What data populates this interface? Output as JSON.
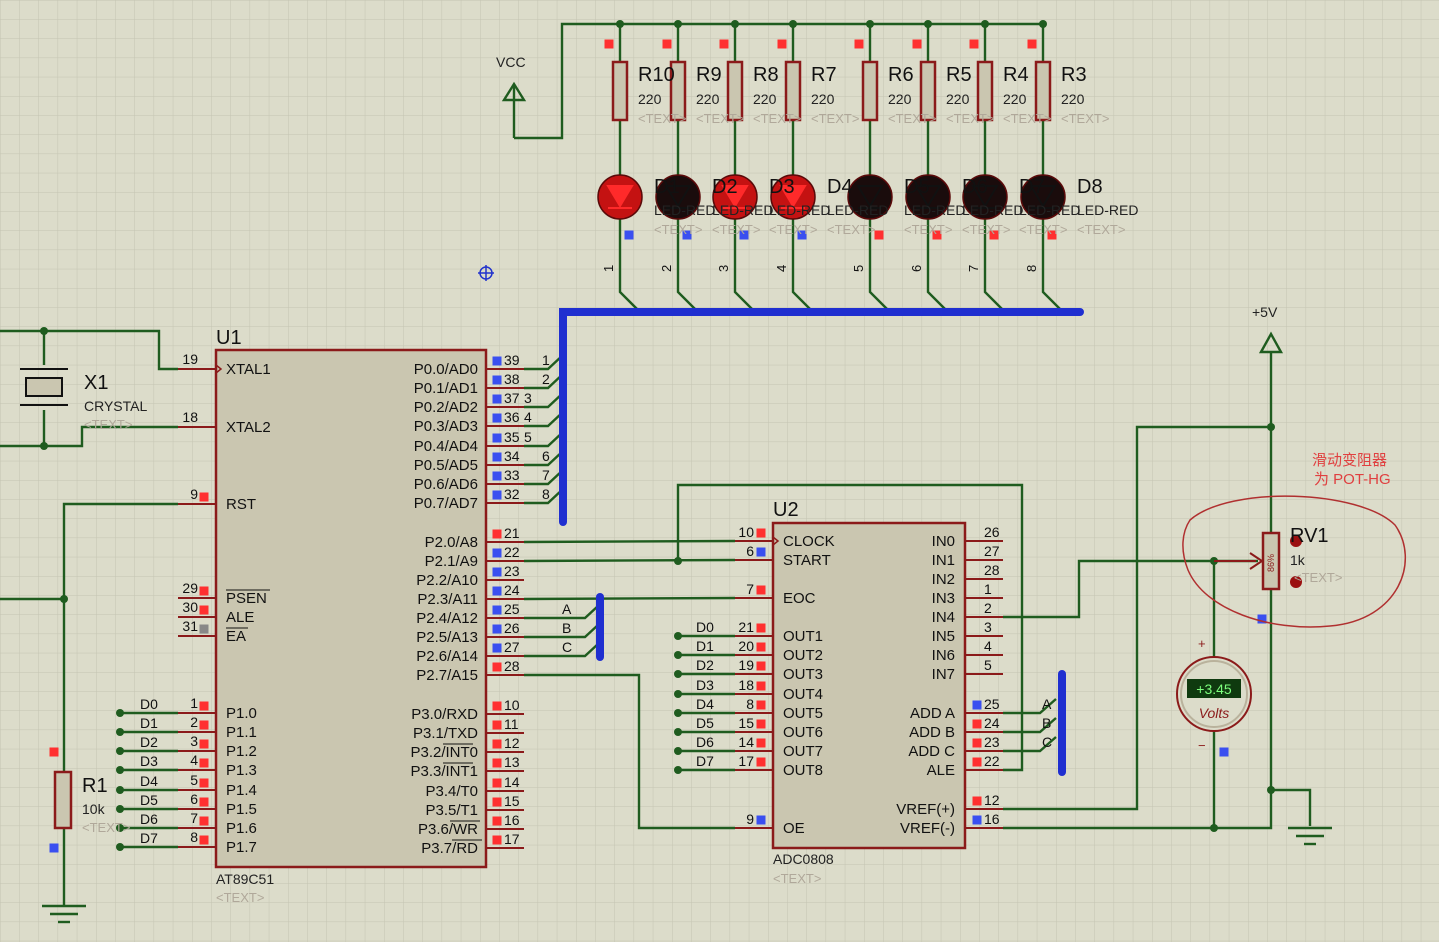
{
  "vcc": {
    "label": "VCC"
  },
  "p5v": {
    "label": "+5V"
  },
  "resistors": [
    {
      "ref": "R10",
      "value": "220"
    },
    {
      "ref": "R9",
      "value": "220"
    },
    {
      "ref": "R8",
      "value": "220"
    },
    {
      "ref": "R7",
      "value": "220"
    },
    {
      "ref": "R6",
      "value": "220"
    },
    {
      "ref": "R5",
      "value": "220"
    },
    {
      "ref": "R4",
      "value": "220"
    },
    {
      "ref": "R3",
      "value": "220"
    }
  ],
  "text_placeholder": "<TEXT>",
  "leds": {
    "refs": [
      "D1",
      "D2",
      "D3",
      "D4",
      "D5",
      "D6",
      "D7",
      "D8"
    ],
    "value": "LED-RED",
    "lit": [
      true,
      false,
      true,
      true,
      false,
      false,
      false,
      false
    ],
    "bus_numbers": [
      "1",
      "2",
      "3",
      "4",
      "5",
      "6",
      "7",
      "8"
    ]
  },
  "u1": {
    "ref": "U1",
    "part": "AT89C51",
    "left_pins": [
      {
        "num": "19",
        "name": "XTAL1"
      },
      {
        "num": "18",
        "name": "XTAL2"
      },
      {
        "num": "9",
        "name": "RST"
      },
      {
        "num": "29",
        "name": "PSEN"
      },
      {
        "num": "30",
        "name": "ALE"
      },
      {
        "num": "31",
        "name": "EA"
      },
      {
        "num": "1",
        "name": "P1.0",
        "net": "D0"
      },
      {
        "num": "2",
        "name": "P1.1",
        "net": "D1"
      },
      {
        "num": "3",
        "name": "P1.2",
        "net": "D2"
      },
      {
        "num": "4",
        "name": "P1.3",
        "net": "D3"
      },
      {
        "num": "5",
        "name": "P1.4",
        "net": "D4"
      },
      {
        "num": "6",
        "name": "P1.5",
        "net": "D5"
      },
      {
        "num": "7",
        "name": "P1.6",
        "net": "D6"
      },
      {
        "num": "8",
        "name": "P1.7",
        "net": "D7"
      }
    ],
    "right_pins": [
      {
        "num": "39",
        "name": "P0.0/AD0",
        "bus": "1"
      },
      {
        "num": "38",
        "name": "P0.1/AD1",
        "bus": "2"
      },
      {
        "num": "37",
        "name": "P0.2/AD2",
        "bus": "3"
      },
      {
        "num": "36",
        "name": "P0.3/AD3",
        "bus": "4"
      },
      {
        "num": "35",
        "name": "P0.4/AD4",
        "bus": "5"
      },
      {
        "num": "34",
        "name": "P0.5/AD5",
        "bus": "6"
      },
      {
        "num": "33",
        "name": "P0.6/AD6",
        "bus": "7"
      },
      {
        "num": "32",
        "name": "P0.7/AD7",
        "bus": "8"
      },
      {
        "num": "21",
        "name": "P2.0/A8"
      },
      {
        "num": "22",
        "name": "P2.1/A9"
      },
      {
        "num": "23",
        "name": "P2.2/A10"
      },
      {
        "num": "24",
        "name": "P2.3/A11"
      },
      {
        "num": "25",
        "name": "P2.4/A12",
        "net": "A"
      },
      {
        "num": "26",
        "name": "P2.5/A13",
        "net": "B"
      },
      {
        "num": "27",
        "name": "P2.6/A14",
        "net": "C"
      },
      {
        "num": "28",
        "name": "P2.7/A15"
      },
      {
        "num": "10",
        "name": "P3.0/RXD"
      },
      {
        "num": "11",
        "name": "P3.1/TXD"
      },
      {
        "num": "12",
        "name": "P3.2/INT0"
      },
      {
        "num": "13",
        "name": "P3.3/INT1"
      },
      {
        "num": "14",
        "name": "P3.4/T0"
      },
      {
        "num": "15",
        "name": "P3.5/T1"
      },
      {
        "num": "16",
        "name": "P3.6/WR"
      },
      {
        "num": "17",
        "name": "P3.7/RD"
      }
    ]
  },
  "u2": {
    "ref": "U2",
    "part": "ADC0808",
    "left_pins": [
      {
        "num": "10",
        "name": "CLOCK"
      },
      {
        "num": "6",
        "name": "START"
      },
      {
        "num": "7",
        "name": "EOC"
      },
      {
        "num": "21",
        "name": "OUT1",
        "net": "D0"
      },
      {
        "num": "20",
        "name": "OUT2",
        "net": "D1"
      },
      {
        "num": "19",
        "name": "OUT3",
        "net": "D2"
      },
      {
        "num": "18",
        "name": "OUT4",
        "net": "D3"
      },
      {
        "num": "8",
        "name": "OUT5",
        "net": "D4"
      },
      {
        "num": "15",
        "name": "OUT6",
        "net": "D5"
      },
      {
        "num": "14",
        "name": "OUT7",
        "net": "D6"
      },
      {
        "num": "17",
        "name": "OUT8",
        "net": "D7"
      },
      {
        "num": "9",
        "name": "OE"
      }
    ],
    "right_pins": [
      {
        "num": "26",
        "name": "IN0"
      },
      {
        "num": "27",
        "name": "IN1"
      },
      {
        "num": "28",
        "name": "IN2"
      },
      {
        "num": "1",
        "name": "IN3"
      },
      {
        "num": "2",
        "name": "IN4"
      },
      {
        "num": "3",
        "name": "IN5"
      },
      {
        "num": "4",
        "name": "IN6"
      },
      {
        "num": "5",
        "name": "IN7"
      },
      {
        "num": "25",
        "name": "ADD A",
        "net": "A"
      },
      {
        "num": "24",
        "name": "ADD B",
        "net": "B"
      },
      {
        "num": "23",
        "name": "ADD C",
        "net": "C"
      },
      {
        "num": "22",
        "name": "ALE"
      },
      {
        "num": "12",
        "name": "VREF(+)"
      },
      {
        "num": "16",
        "name": "VREF(-)"
      }
    ]
  },
  "x1": {
    "ref": "X1",
    "value": "CRYSTAL"
  },
  "r1": {
    "ref": "R1",
    "value": "10k"
  },
  "rv1": {
    "ref": "RV1",
    "value": "1k",
    "wiper": "86%"
  },
  "voltmeter": {
    "reading": "+3.45",
    "unit": "Volts",
    "plus": "+",
    "minus": "−"
  },
  "annotation": {
    "line1": "滑动变阻器",
    "line2": "为 POT-HG"
  },
  "colors": {
    "background": "#dcdcca",
    "grid": "#c6c6b4",
    "wire": "#1f5c1f",
    "bus": "#1f2fd0",
    "component_outline": "#8b1a1a",
    "component_fill": "#cac6b0",
    "pin_high": "#ff3030",
    "pin_low": "#3a4ff0",
    "led_on": "#c41212",
    "led_off": "#1a0c0c",
    "annotation": "#e04040"
  }
}
